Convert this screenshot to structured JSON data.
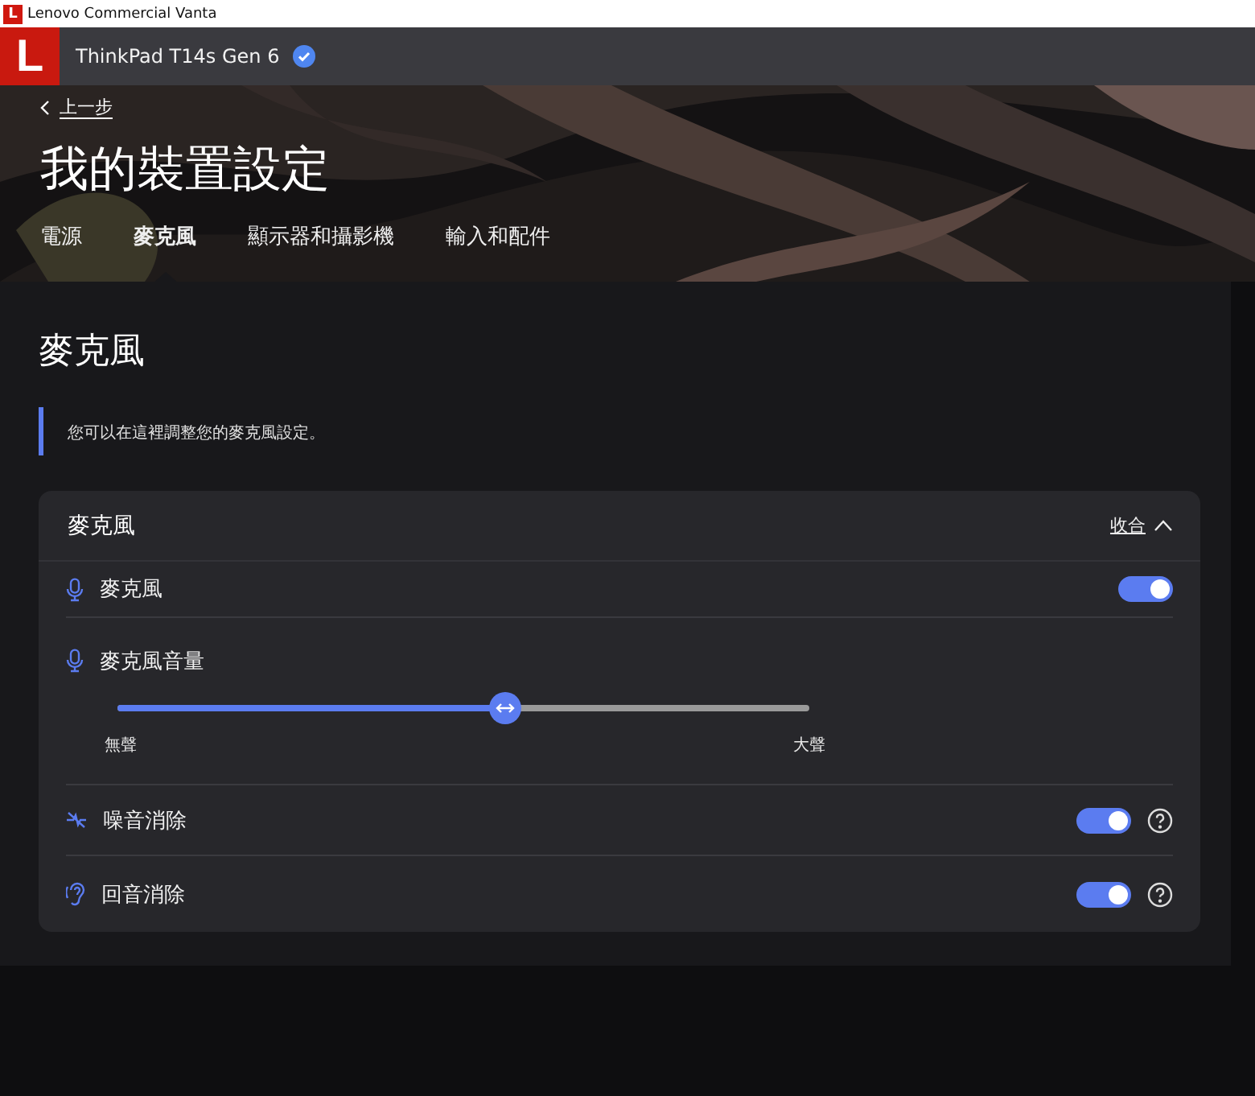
{
  "window": {
    "app_icon": "L",
    "title": "Lenovo Commercial Vanta"
  },
  "device_bar": {
    "logo": "L",
    "device": "ThinkPad T14s Gen 6",
    "verified": true
  },
  "header": {
    "back": "上一步",
    "title": "我的裝置設定",
    "tabs": [
      {
        "label": "電源",
        "selected": false
      },
      {
        "label": "麥克風",
        "selected": true
      },
      {
        "label": "顯示器和攝影機",
        "selected": false
      },
      {
        "label": "輸入和配件",
        "selected": false
      }
    ]
  },
  "section": {
    "title": "麥克風",
    "note": "您可以在這裡調整您的麥克風設定。"
  },
  "card": {
    "title": "麥克風",
    "collapse": "收合",
    "expanded": true,
    "rows": [
      {
        "kind": "toggle",
        "label": "麥克風",
        "on": true,
        "help": false
      },
      {
        "kind": "slider",
        "label": "麥克風音量",
        "level": 0.56,
        "min_label": "無聲",
        "max_label": "大聲"
      },
      {
        "kind": "toggle",
        "label": "噪音消除",
        "on": true,
        "help": true
      },
      {
        "kind": "toggle",
        "label": "回音消除",
        "on": true,
        "help": true
      }
    ]
  }
}
